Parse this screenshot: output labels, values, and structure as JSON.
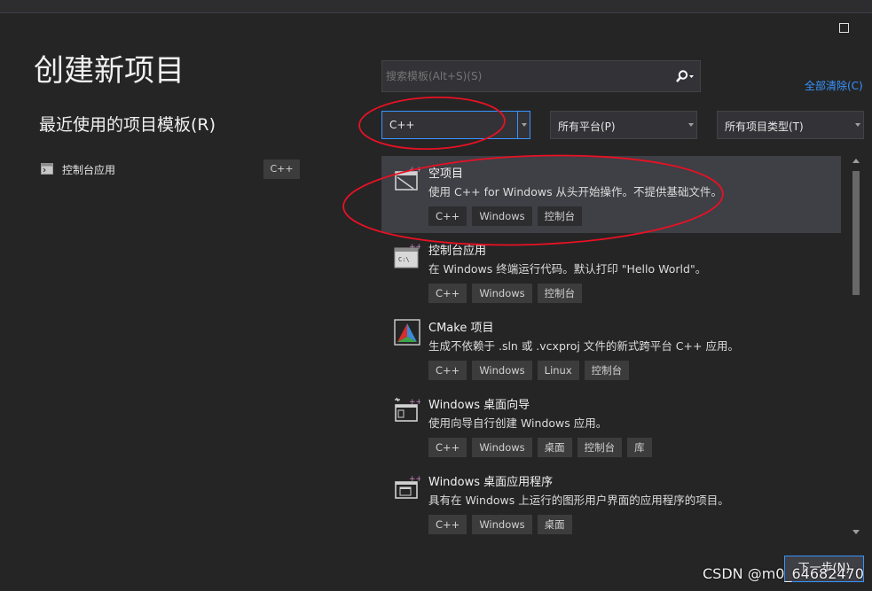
{
  "page_title": "创建新项目",
  "recent": {
    "title": "最近使用的项目模板(R)",
    "items": [
      {
        "label": "控制台应用",
        "tag": "C++"
      }
    ]
  },
  "search": {
    "placeholder": "搜索模板(Alt+S)(S)"
  },
  "clear_all": "全部清除(C)",
  "filters": {
    "language": "C++",
    "platform": "所有平台(P)",
    "project_type": "所有项目类型(T)"
  },
  "templates": [
    {
      "name": "空项目",
      "description": "使用 C++ for Windows 从头开始操作。不提供基础文件。",
      "tags": [
        "C++",
        "Windows",
        "控制台"
      ],
      "icon": "empty-project-icon"
    },
    {
      "name": "控制台应用",
      "description": "在 Windows 终端运行代码。默认打印 \"Hello World\"。",
      "tags": [
        "C++",
        "Windows",
        "控制台"
      ],
      "icon": "console-app-icon",
      "icon_text": "C:\\"
    },
    {
      "name": "CMake 项目",
      "description": "生成不依赖于 .sln 或 .vcxproj 文件的新式跨平台 C++ 应用。",
      "tags": [
        "C++",
        "Windows",
        "Linux",
        "控制台"
      ],
      "icon": "cmake-icon"
    },
    {
      "name": "Windows 桌面向导",
      "description": "使用向导自行创建 Windows 应用。",
      "tags": [
        "C++",
        "Windows",
        "桌面",
        "控制台",
        "库"
      ],
      "icon": "desktop-wizard-icon"
    },
    {
      "name": "Windows 桌面应用程序",
      "description": "具有在 Windows 上运行的图形用户界面的应用程序的项目。",
      "tags": [
        "C++",
        "Windows",
        "桌面"
      ],
      "icon": "desktop-app-icon"
    }
  ],
  "next_button": "下一步(N)",
  "watermark": "CSDN @m0_64682470",
  "colors": {
    "accent": "#3794ff",
    "annotation": "#e81123",
    "background": "#252526",
    "selected": "#3f3f46"
  }
}
